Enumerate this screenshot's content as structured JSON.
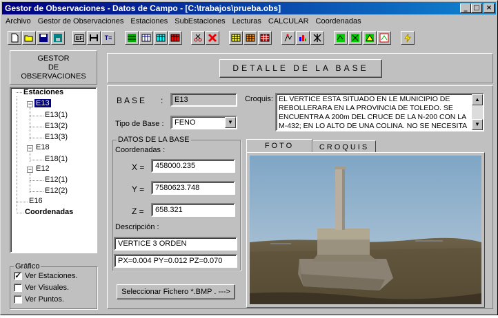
{
  "window": {
    "title": "Gestor de Observaciones - Datos de Campo - [C:\\trabajos\\prueba.obs]",
    "controls": {
      "minimize": "_",
      "maximize": "□",
      "close": "×"
    }
  },
  "menu": [
    "Archivo",
    "Gestor de Observaciones",
    "Estaciones",
    "SubEstaciones",
    "Lecturas",
    "CALCULAR",
    "Coordenadas"
  ],
  "toolbar": {
    "icons": [
      "new-icon",
      "open-icon",
      "save-icon",
      "disk-icon",
      "card-icon",
      "weight-icon",
      "text-icon",
      "grid-icon",
      "table-icon",
      "table2-icon",
      "table3-icon",
      "scissors-icon",
      "delete-icon",
      "grid4-icon",
      "grid5-icon",
      "grid6-icon",
      "calc-icon",
      "chart-icon",
      "tool-icon",
      "map-icon",
      "map2-icon",
      "map3-icon",
      "map4-icon",
      "flash-icon"
    ],
    "text_icons": {
      "ef": "EF",
      "te": "T≡"
    }
  },
  "left_panel": {
    "header": [
      "GESTOR",
      "DE",
      "OBSERVACIONES"
    ],
    "tree": {
      "root_estaciones": "Estaciones",
      "e13": "E13",
      "e13_children": [
        "E13(1)",
        "E13(2)",
        "E13(3)"
      ],
      "e18": "E18",
      "e18_children": [
        "E18(1)"
      ],
      "e12": "E12",
      "e12_children": [
        "E12(1)",
        "E12(2)"
      ],
      "e16": "E16",
      "coordenadas": "Coordenadas"
    },
    "grafico": {
      "label": "Gráfico",
      "options": [
        {
          "label": "Ver Estaciones.",
          "checked": true
        },
        {
          "label": "Ver Visuales.",
          "checked": false
        },
        {
          "label": "Ver Puntos.",
          "checked": false
        }
      ]
    }
  },
  "detalle_button": "DETALLE  DE  LA  BASE",
  "base": {
    "label": "BASE",
    "separator": ":",
    "value": "E13",
    "tipo_label": "Tipo de Base :",
    "tipo_value": "FENO"
  },
  "croquis": {
    "label": "Croquis:",
    "text": "EL VERTICE ESTA SITUADO EN LE MUNICIPIO DE REBOLLERARA EN LA PROVINCIA DE TOLEDO. SE ENCUENTRA A 200m DEL CRUCE DE LA  N-200 CON LA M-432; EN LO ALTO DE UNA COLINA. NO SE NECESITA"
  },
  "datos": {
    "group_label": "DATOS DE LA BASE",
    "coordenadas_label": "Coordenadas :",
    "x_label": "X =",
    "x_value": "458000.235",
    "y_label": "Y =",
    "y_value": "7580623.748",
    "z_label": "Z =",
    "z_value": "658.321",
    "descripcion_label": "Descripción    :",
    "descripcion_value": "VERTICE 3 ORDEN",
    "precision_value": "PX=0.004  PY=0.012  PZ=0.070"
  },
  "tabs": {
    "foto": "FOTO",
    "croquis": "CROQUIS"
  },
  "select_file_button": "Seleccionar Fichero  *.BMP . --->"
}
